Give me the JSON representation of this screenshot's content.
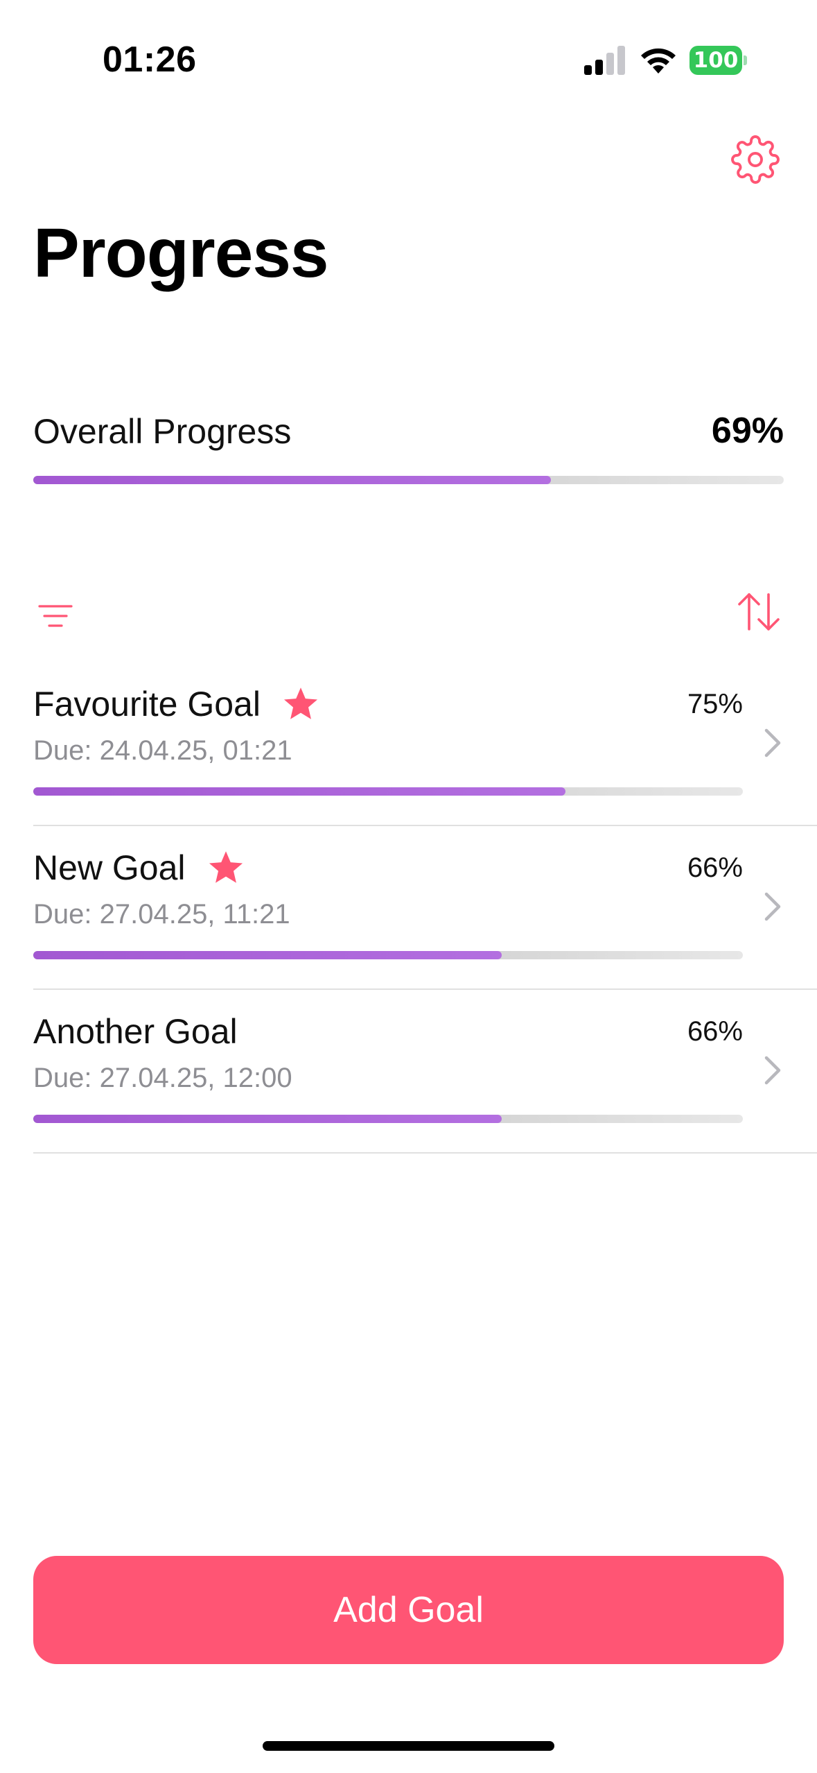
{
  "status_bar": {
    "time": "01:26",
    "battery": "100",
    "signal_icon": "cellular-signal-icon",
    "wifi_icon": "wifi-icon"
  },
  "header": {
    "settings_icon": "gear-icon",
    "title": "Progress"
  },
  "overall": {
    "label": "Overall Progress",
    "percent_text": "69%",
    "progress": 0.69
  },
  "toolbar": {
    "filter_icon": "filter-lines-icon",
    "sort_icon": "sort-arrows-icon"
  },
  "goals": [
    {
      "title": "Favourite Goal",
      "favourite": true,
      "due": "Due: 24.04.25, 01:21",
      "percent_text": "75%",
      "progress": 0.75
    },
    {
      "title": "New Goal",
      "favourite": true,
      "due": "Due: 27.04.25, 11:21",
      "percent_text": "66%",
      "progress": 0.66
    },
    {
      "title": "Another Goal",
      "favourite": false,
      "due": "Due: 27.04.25, 12:00",
      "percent_text": "66%",
      "progress": 0.66
    }
  ],
  "actions": {
    "add_goal_label": "Add Goal"
  },
  "colors": {
    "accent": "#ff5574",
    "progress_fill": "#a95fd8",
    "progress_track": "#d8d8d8",
    "battery": "#34c759",
    "secondary_text": "#8e8e93"
  }
}
